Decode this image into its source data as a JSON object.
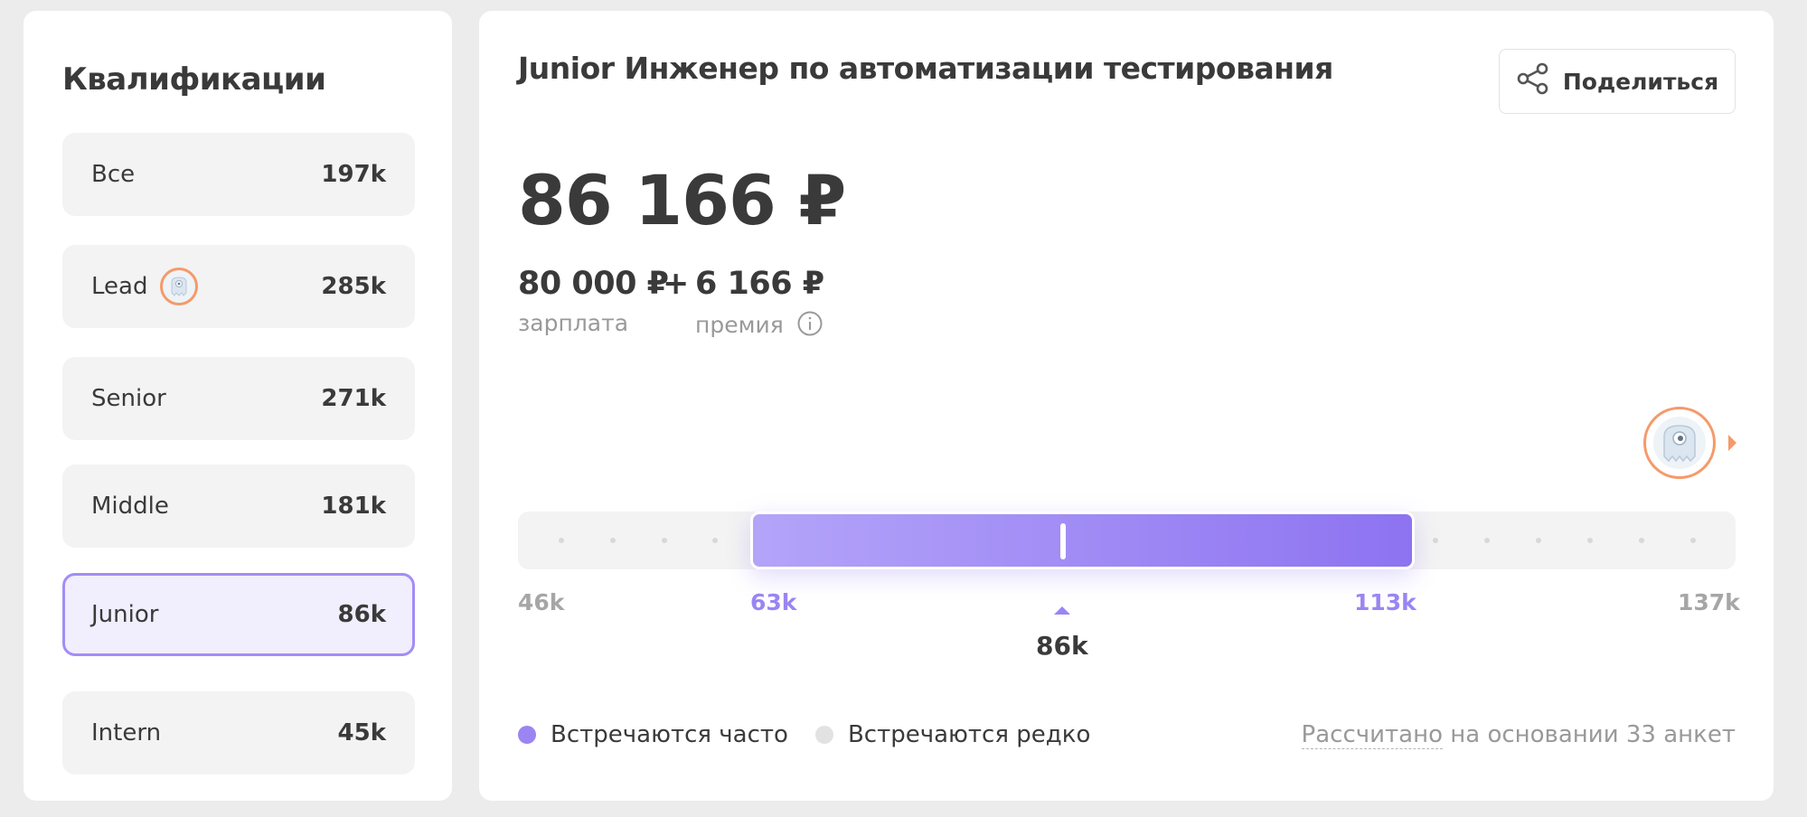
{
  "qualifications": {
    "title": "Квалификации",
    "items": [
      {
        "name": "Все",
        "value": "197k"
      },
      {
        "name": "Lead",
        "value": "285k"
      },
      {
        "name": "Senior",
        "value": "271k"
      },
      {
        "name": "Middle",
        "value": "181k"
      },
      {
        "name": "Junior",
        "value": "86k"
      },
      {
        "name": "Intern",
        "value": "45k"
      }
    ],
    "selected": "Junior"
  },
  "main": {
    "job_title": "Junior Инженер по автоматизации тестирования",
    "share_label": "Поделиться",
    "total": "86 166 ₽",
    "salary": "80 000 ₽",
    "plus": "+",
    "bonus": "6 166 ₽",
    "salary_label": "зарплата",
    "bonus_label": "премия"
  },
  "range": {
    "min_label": "46k",
    "low_label": "63k",
    "high_label": "113k",
    "max_label": "137k",
    "median_label": "86k"
  },
  "legend": {
    "frequent": "Встречаются часто",
    "rare": "Встречаются редко",
    "frequent_color": "#9a85f3",
    "rare_color": "#e2e2e2"
  },
  "footnote": {
    "link": "Рассчитано",
    "rest": " на основании 33 анкет"
  }
}
